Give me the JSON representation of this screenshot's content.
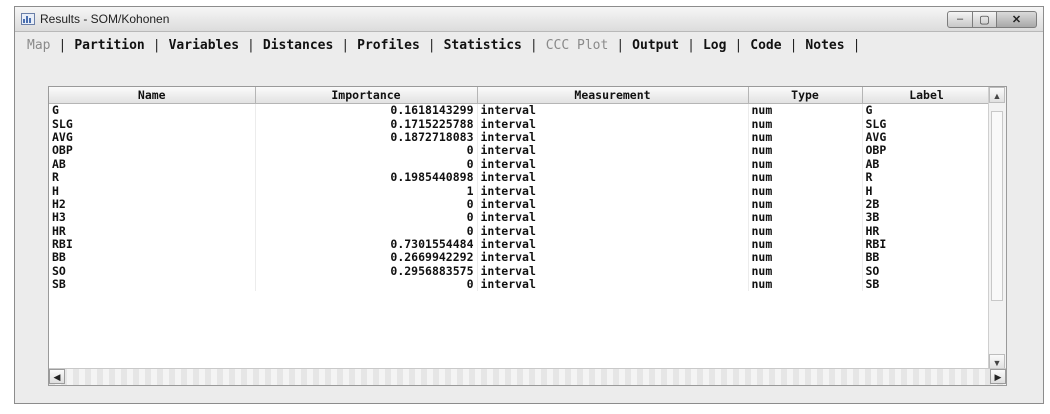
{
  "window": {
    "title": "Results - SOM/Kohonen",
    "controls": {
      "minimize": "–",
      "maximize": "▢",
      "close": "✕"
    }
  },
  "tabs": [
    {
      "label": "Map",
      "disabled": true
    },
    {
      "label": "Partition",
      "disabled": false
    },
    {
      "label": "Variables",
      "disabled": false
    },
    {
      "label": "Distances",
      "disabled": false
    },
    {
      "label": "Profiles",
      "disabled": false
    },
    {
      "label": "Statistics",
      "disabled": false
    },
    {
      "label": "CCC Plot",
      "disabled": true
    },
    {
      "label": "Output",
      "disabled": false
    },
    {
      "label": "Log",
      "disabled": false
    },
    {
      "label": "Code",
      "disabled": false
    },
    {
      "label": "Notes",
      "disabled": false
    }
  ],
  "table": {
    "columns": [
      "Name",
      "Importance",
      "Measurement",
      "Type",
      "Label"
    ],
    "rows": [
      [
        "G",
        "0.1618143299",
        "interval",
        "num",
        "G"
      ],
      [
        "SLG",
        "0.1715225788",
        "interval",
        "num",
        "SLG"
      ],
      [
        "AVG",
        "0.1872718083",
        "interval",
        "num",
        "AVG"
      ],
      [
        "OBP",
        "0",
        "interval",
        "num",
        "OBP"
      ],
      [
        "AB",
        "0",
        "interval",
        "num",
        "AB"
      ],
      [
        "R",
        "0.1985440898",
        "interval",
        "num",
        "R"
      ],
      [
        "H",
        "1",
        "interval",
        "num",
        "H"
      ],
      [
        "H2",
        "0",
        "interval",
        "num",
        "2B"
      ],
      [
        "H3",
        "0",
        "interval",
        "num",
        "3B"
      ],
      [
        "HR",
        "0",
        "interval",
        "num",
        "HR"
      ],
      [
        "RBI",
        "0.7301554484",
        "interval",
        "num",
        "RBI"
      ],
      [
        "BB",
        "0.2669942292",
        "interval",
        "num",
        "BB"
      ],
      [
        "SO",
        "0.2956883575",
        "interval",
        "num",
        "SO"
      ],
      [
        "SB",
        "0",
        "interval",
        "num",
        "SB"
      ]
    ]
  },
  "scrollbars": {
    "up": "▲",
    "down": "▼",
    "left": "◀",
    "right": "▶"
  }
}
